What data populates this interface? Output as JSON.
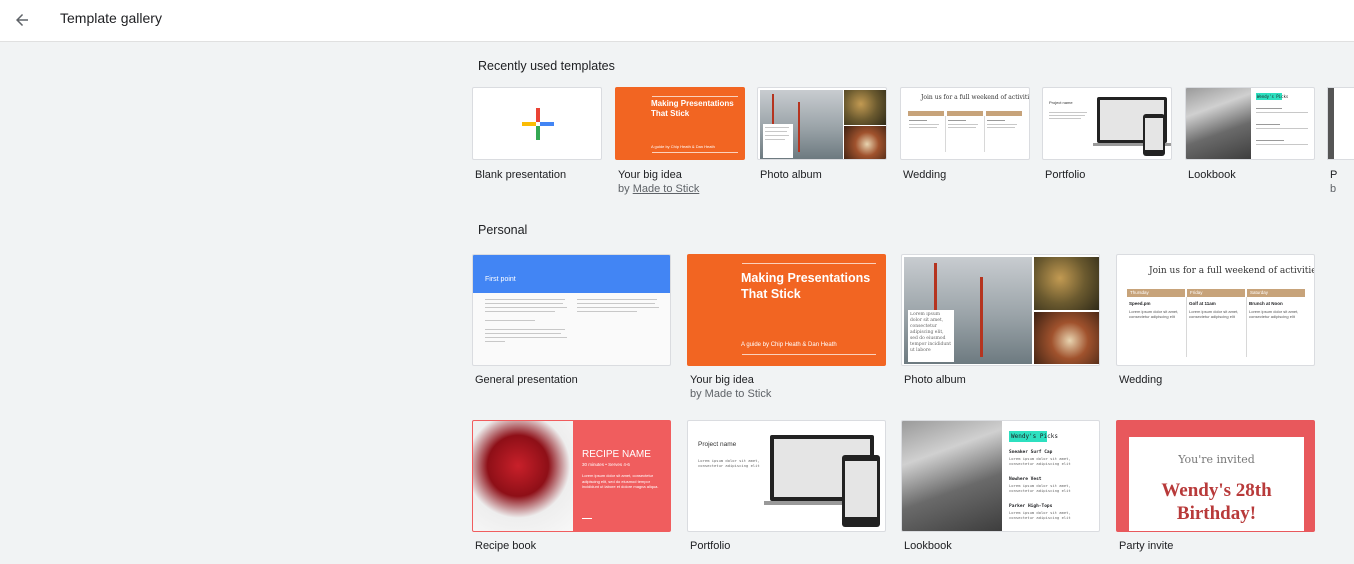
{
  "header": {
    "back_icon": "arrow-back-icon",
    "title": "Template gallery"
  },
  "sections": {
    "recent": "Recently used templates",
    "personal": "Personal"
  },
  "recent": [
    {
      "name": "Blank presentation",
      "sub": ""
    },
    {
      "name": "Your big idea",
      "sub_prefix": "by ",
      "sub_link": "Made to Stick"
    },
    {
      "name": "Photo album",
      "sub": ""
    },
    {
      "name": "Wedding",
      "sub": ""
    },
    {
      "name": "Portfolio",
      "sub": ""
    },
    {
      "name": "Lookbook",
      "sub": ""
    },
    {
      "name": "P",
      "sub": "b"
    }
  ],
  "personal": [
    {
      "name": "General presentation"
    },
    {
      "name": "Your big idea",
      "sub": "by Made to Stick"
    },
    {
      "name": "Photo album"
    },
    {
      "name": "Wedding"
    },
    {
      "name": "Recipe book"
    },
    {
      "name": "Portfolio"
    },
    {
      "name": "Lookbook"
    },
    {
      "name": "Party invite"
    }
  ],
  "thumbs": {
    "bigidea_title": "Making Presentations That Stick",
    "bigidea_byline": "A guide by Chip Heath & Dan Heath",
    "general_title": "First point",
    "general_sub": "Lorem ipsum dolor sit amet, consectetur adipiscing elit, sed do eiusmod tempor",
    "photo_caption": "Lorem ipsum dolor sit amet, consectetur adipiscing elit, sed do eiusmod tempor incididunt ut labore",
    "wedding_heading": "Join us for a full weekend of activities!",
    "wedding_days": [
      "Thursday",
      "Friday",
      "Saturday"
    ],
    "wedding_events": [
      "Speed.pm",
      "Golf at 11am",
      "Brunch at Noon"
    ],
    "wedding_body": "Lorem ipsum dolor sit amet, consectetur adipiscing elit",
    "portfolio_heading": "Project name",
    "portfolio_body": "Lorem ipsum dolor sit amet, consectetur adipiscing elit",
    "lookbook_tag": "Wendy's Picks",
    "lookbook_items": [
      "Sneaker Surf Cap",
      "Nowhere Vest",
      "Parker High-Tops"
    ],
    "lookbook_body": "Lorem ipsum dolor sit amet, consectetur adipiscing elit",
    "recipe_name": "RECIPE NAME",
    "recipe_meta": "30 minutes • Serves 4-6",
    "recipe_body": "Lorem ipsum dolor sit amet, consectetur adipiscing elit, sed do eiusmod tempor incididunt ut labore et dolore magna aliqua.",
    "party_invited": "You're invited",
    "party_title": "Wendy's 28th Birthday!"
  },
  "colors": {
    "accent_orange": "#f26522",
    "general_blue": "#4285f4",
    "recipe_red": "#f05d5e",
    "party_red": "#e8585c",
    "party_title": "#b83a3a",
    "lookbook_teal": "#2de0c0"
  }
}
